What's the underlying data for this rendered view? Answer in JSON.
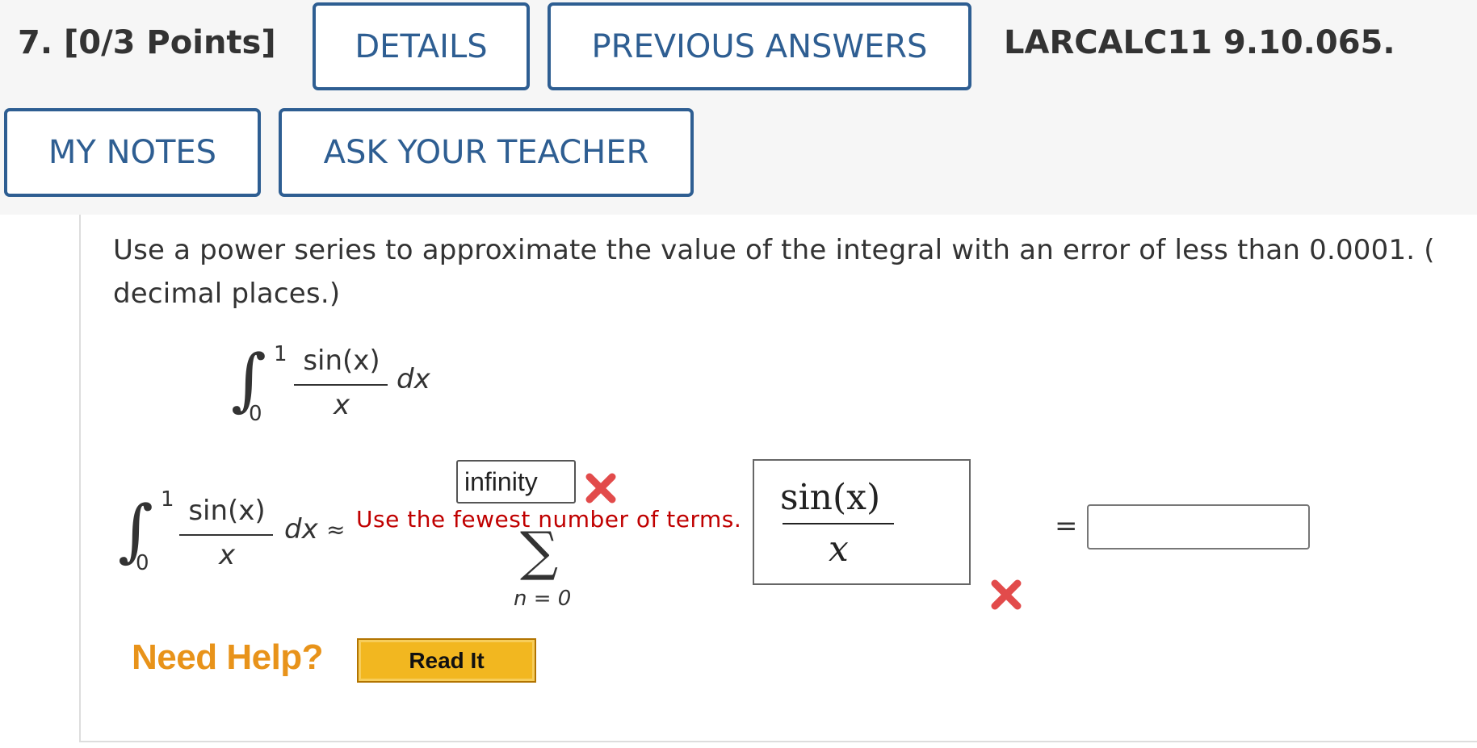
{
  "question": {
    "number_points": "7.  [0/3 Points]",
    "code": "LARCALC11 9.10.065."
  },
  "buttons": {
    "details": "DETAILS",
    "previous_answers": "PREVIOUS ANSWERS",
    "my_notes": "MY NOTES",
    "ask_teacher": "ASK YOUR TEACHER"
  },
  "prompt": {
    "line1": "Use a power series to approximate the value of the integral with an error of less than 0.0001. (",
    "line2": "decimal places.)"
  },
  "integral_display": {
    "upper": "1",
    "lower": "0",
    "numerator": "sin(x)",
    "denominator": "x",
    "differential": "dx"
  },
  "answer_row": {
    "upper": "1",
    "lower": "0",
    "numerator": "sin(x)",
    "denominator": "x",
    "differential": "dx",
    "approx_symbol": "≈",
    "sum_upper_value": "infinity",
    "sum_lower_label": "n = 0",
    "error_message": "Use the fewest number of terms.",
    "term_numerator": "sin(x)",
    "term_denominator": "x",
    "equals": "=",
    "answer_value": ""
  },
  "help": {
    "need_help": "Need Help?",
    "read_it": "Read It"
  },
  "icons": {
    "incorrect": "x-mark-icon",
    "summation": "sigma-icon",
    "integral": "integral-sign-icon"
  },
  "colors": {
    "button_border": "#2e5e92",
    "error_red": "#c00000",
    "x_mark": "#e24b4b",
    "need_help_orange": "#e8931a",
    "read_it_fill": "#f2b720"
  }
}
